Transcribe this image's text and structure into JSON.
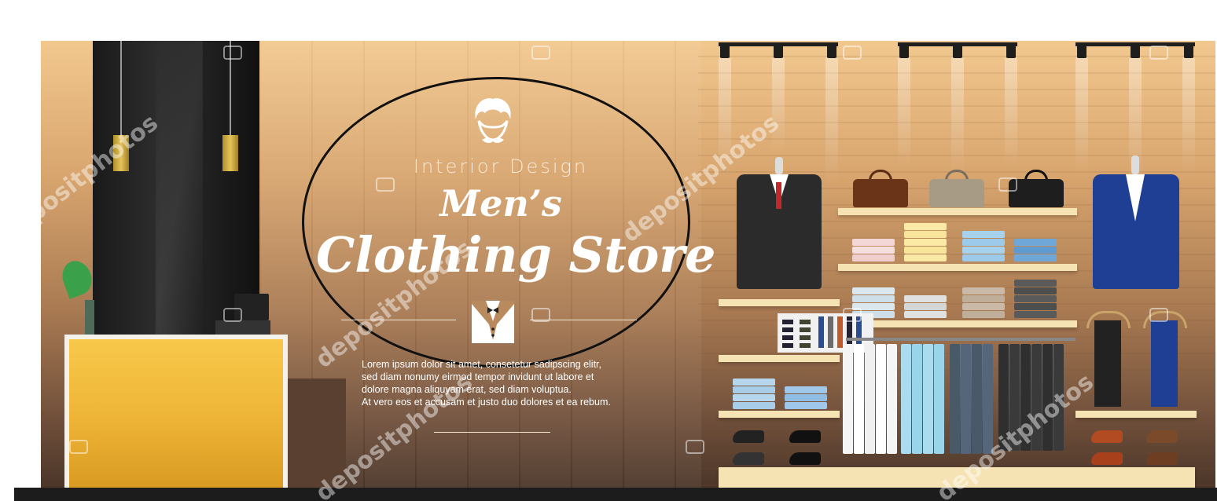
{
  "branding": {
    "subtitle": "Interior Design",
    "title_line1": "Men’s",
    "title_line2": "Clothing Store"
  },
  "body_text": {
    "lines": [
      "Lorem ipsum dolor sit amet, consetetur sadipscing elitr,",
      "sed diam nonumy eirmod tempor invidunt ut labore et",
      "dolore magna aliquyam erat, sed diam voluptua.",
      "At vero eos et accusam et justo duo dolores et ea rebum."
    ]
  },
  "watermarks": [
    "depositphotos",
    "depositphotos",
    "depositphotos",
    "depositphotos",
    "depositphotos"
  ],
  "colors": {
    "accent_counter": "#f0b83a",
    "suit_black": "#2b2b2b",
    "suit_blue": "#1e3f94",
    "tie_red": "#c0282c",
    "shelf": "#f6e3b4"
  },
  "icons": [
    "mustache-man-icon",
    "tuxedo-icon",
    "camera-icon"
  ]
}
